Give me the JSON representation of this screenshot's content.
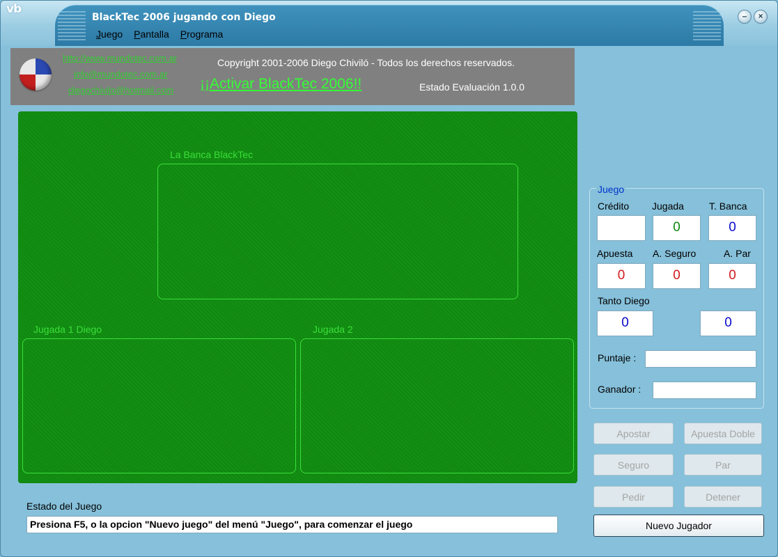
{
  "window": {
    "logo": "vb",
    "title": "BlackTec 2006 jugando con Diego",
    "minimize_icon": "minimize-icon",
    "close_icon": "close-icon"
  },
  "menu": [
    {
      "underline": "J",
      "rest": "uego"
    },
    {
      "underline": "P",
      "rest": "antalla"
    },
    {
      "underline": "P",
      "rest": "rograma"
    }
  ],
  "banner": {
    "links": [
      "http://www.mundotec.com.ar",
      "info@mundotec.com.ar",
      "diegochivilo@hotmail.com"
    ],
    "copyright": "Copyright 2001-2006 Diego Chiviló - Todos los derechos reservados.",
    "activar": "¡¡Activar BlackTec 2006!!",
    "estado_eval": "Estado Evaluación 1.0.0",
    "logo_icon": "globe-logo-icon"
  },
  "table": {
    "banca_label": "La Banca BlackTec",
    "jugada1_label": "Jugada 1  Diego",
    "jugada2_label": "Jugada 2"
  },
  "status": {
    "label": "Estado del Juego",
    "message": "Presiona F5, o la opcion \"Nuevo juego\" del menú \"Juego\", para comenzar el juego"
  },
  "panel": {
    "group_title": "Juego",
    "credito_label": "Crédito",
    "credito_value": "",
    "jugada_label": "Jugada",
    "jugada_value": "0",
    "tbanca_label": "T. Banca",
    "tbanca_value": "0",
    "apuesta_label": "Apuesta",
    "apuesta_value": "0",
    "aseguro_label": "A. Seguro",
    "aseguro_value": "0",
    "apar_label": "A. Par",
    "apar_value": "0",
    "tanto_label": "Tanto Diego",
    "tanto_value": "0",
    "tanto_banca_value": "0",
    "puntaje_label": "Puntaje :",
    "puntaje_value": "",
    "ganador_label": "Ganador :",
    "ganador_value": ""
  },
  "buttons": {
    "apostar": "Apostar",
    "apuesta_doble": "Apuesta Doble",
    "seguro": "Seguro",
    "par": "Par",
    "pedir": "Pedir",
    "detener": "Detener",
    "nuevo_jugador": "Nuevo Jugador"
  },
  "colors": {
    "felt": "#0f8a0f",
    "felt_line": "#3adf3a",
    "link": "#33cc33",
    "value_green": "#0c8a0c",
    "value_blue": "#0a0ad0",
    "value_red": "#d21a1a"
  }
}
